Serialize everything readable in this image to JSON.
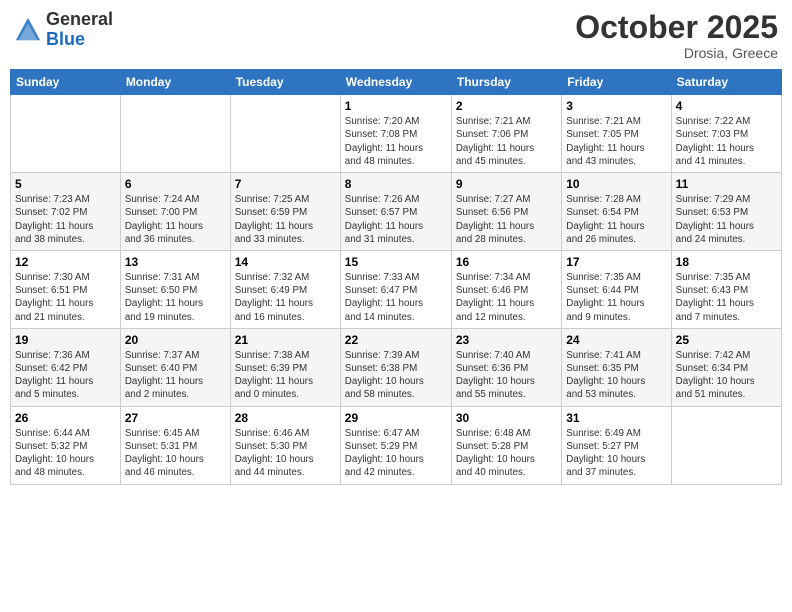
{
  "header": {
    "logo_line1": "General",
    "logo_line2": "Blue",
    "month": "October 2025",
    "location": "Drosia, Greece"
  },
  "days_of_week": [
    "Sunday",
    "Monday",
    "Tuesday",
    "Wednesday",
    "Thursday",
    "Friday",
    "Saturday"
  ],
  "weeks": [
    [
      {
        "num": "",
        "info": ""
      },
      {
        "num": "",
        "info": ""
      },
      {
        "num": "",
        "info": ""
      },
      {
        "num": "1",
        "info": "Sunrise: 7:20 AM\nSunset: 7:08 PM\nDaylight: 11 hours\nand 48 minutes."
      },
      {
        "num": "2",
        "info": "Sunrise: 7:21 AM\nSunset: 7:06 PM\nDaylight: 11 hours\nand 45 minutes."
      },
      {
        "num": "3",
        "info": "Sunrise: 7:21 AM\nSunset: 7:05 PM\nDaylight: 11 hours\nand 43 minutes."
      },
      {
        "num": "4",
        "info": "Sunrise: 7:22 AM\nSunset: 7:03 PM\nDaylight: 11 hours\nand 41 minutes."
      }
    ],
    [
      {
        "num": "5",
        "info": "Sunrise: 7:23 AM\nSunset: 7:02 PM\nDaylight: 11 hours\nand 38 minutes."
      },
      {
        "num": "6",
        "info": "Sunrise: 7:24 AM\nSunset: 7:00 PM\nDaylight: 11 hours\nand 36 minutes."
      },
      {
        "num": "7",
        "info": "Sunrise: 7:25 AM\nSunset: 6:59 PM\nDaylight: 11 hours\nand 33 minutes."
      },
      {
        "num": "8",
        "info": "Sunrise: 7:26 AM\nSunset: 6:57 PM\nDaylight: 11 hours\nand 31 minutes."
      },
      {
        "num": "9",
        "info": "Sunrise: 7:27 AM\nSunset: 6:56 PM\nDaylight: 11 hours\nand 28 minutes."
      },
      {
        "num": "10",
        "info": "Sunrise: 7:28 AM\nSunset: 6:54 PM\nDaylight: 11 hours\nand 26 minutes."
      },
      {
        "num": "11",
        "info": "Sunrise: 7:29 AM\nSunset: 6:53 PM\nDaylight: 11 hours\nand 24 minutes."
      }
    ],
    [
      {
        "num": "12",
        "info": "Sunrise: 7:30 AM\nSunset: 6:51 PM\nDaylight: 11 hours\nand 21 minutes."
      },
      {
        "num": "13",
        "info": "Sunrise: 7:31 AM\nSunset: 6:50 PM\nDaylight: 11 hours\nand 19 minutes."
      },
      {
        "num": "14",
        "info": "Sunrise: 7:32 AM\nSunset: 6:49 PM\nDaylight: 11 hours\nand 16 minutes."
      },
      {
        "num": "15",
        "info": "Sunrise: 7:33 AM\nSunset: 6:47 PM\nDaylight: 11 hours\nand 14 minutes."
      },
      {
        "num": "16",
        "info": "Sunrise: 7:34 AM\nSunset: 6:46 PM\nDaylight: 11 hours\nand 12 minutes."
      },
      {
        "num": "17",
        "info": "Sunrise: 7:35 AM\nSunset: 6:44 PM\nDaylight: 11 hours\nand 9 minutes."
      },
      {
        "num": "18",
        "info": "Sunrise: 7:35 AM\nSunset: 6:43 PM\nDaylight: 11 hours\nand 7 minutes."
      }
    ],
    [
      {
        "num": "19",
        "info": "Sunrise: 7:36 AM\nSunset: 6:42 PM\nDaylight: 11 hours\nand 5 minutes."
      },
      {
        "num": "20",
        "info": "Sunrise: 7:37 AM\nSunset: 6:40 PM\nDaylight: 11 hours\nand 2 minutes."
      },
      {
        "num": "21",
        "info": "Sunrise: 7:38 AM\nSunset: 6:39 PM\nDaylight: 11 hours\nand 0 minutes."
      },
      {
        "num": "22",
        "info": "Sunrise: 7:39 AM\nSunset: 6:38 PM\nDaylight: 10 hours\nand 58 minutes."
      },
      {
        "num": "23",
        "info": "Sunrise: 7:40 AM\nSunset: 6:36 PM\nDaylight: 10 hours\nand 55 minutes."
      },
      {
        "num": "24",
        "info": "Sunrise: 7:41 AM\nSunset: 6:35 PM\nDaylight: 10 hours\nand 53 minutes."
      },
      {
        "num": "25",
        "info": "Sunrise: 7:42 AM\nSunset: 6:34 PM\nDaylight: 10 hours\nand 51 minutes."
      }
    ],
    [
      {
        "num": "26",
        "info": "Sunrise: 6:44 AM\nSunset: 5:32 PM\nDaylight: 10 hours\nand 48 minutes."
      },
      {
        "num": "27",
        "info": "Sunrise: 6:45 AM\nSunset: 5:31 PM\nDaylight: 10 hours\nand 46 minutes."
      },
      {
        "num": "28",
        "info": "Sunrise: 6:46 AM\nSunset: 5:30 PM\nDaylight: 10 hours\nand 44 minutes."
      },
      {
        "num": "29",
        "info": "Sunrise: 6:47 AM\nSunset: 5:29 PM\nDaylight: 10 hours\nand 42 minutes."
      },
      {
        "num": "30",
        "info": "Sunrise: 6:48 AM\nSunset: 5:28 PM\nDaylight: 10 hours\nand 40 minutes."
      },
      {
        "num": "31",
        "info": "Sunrise: 6:49 AM\nSunset: 5:27 PM\nDaylight: 10 hours\nand 37 minutes."
      },
      {
        "num": "",
        "info": ""
      }
    ]
  ]
}
